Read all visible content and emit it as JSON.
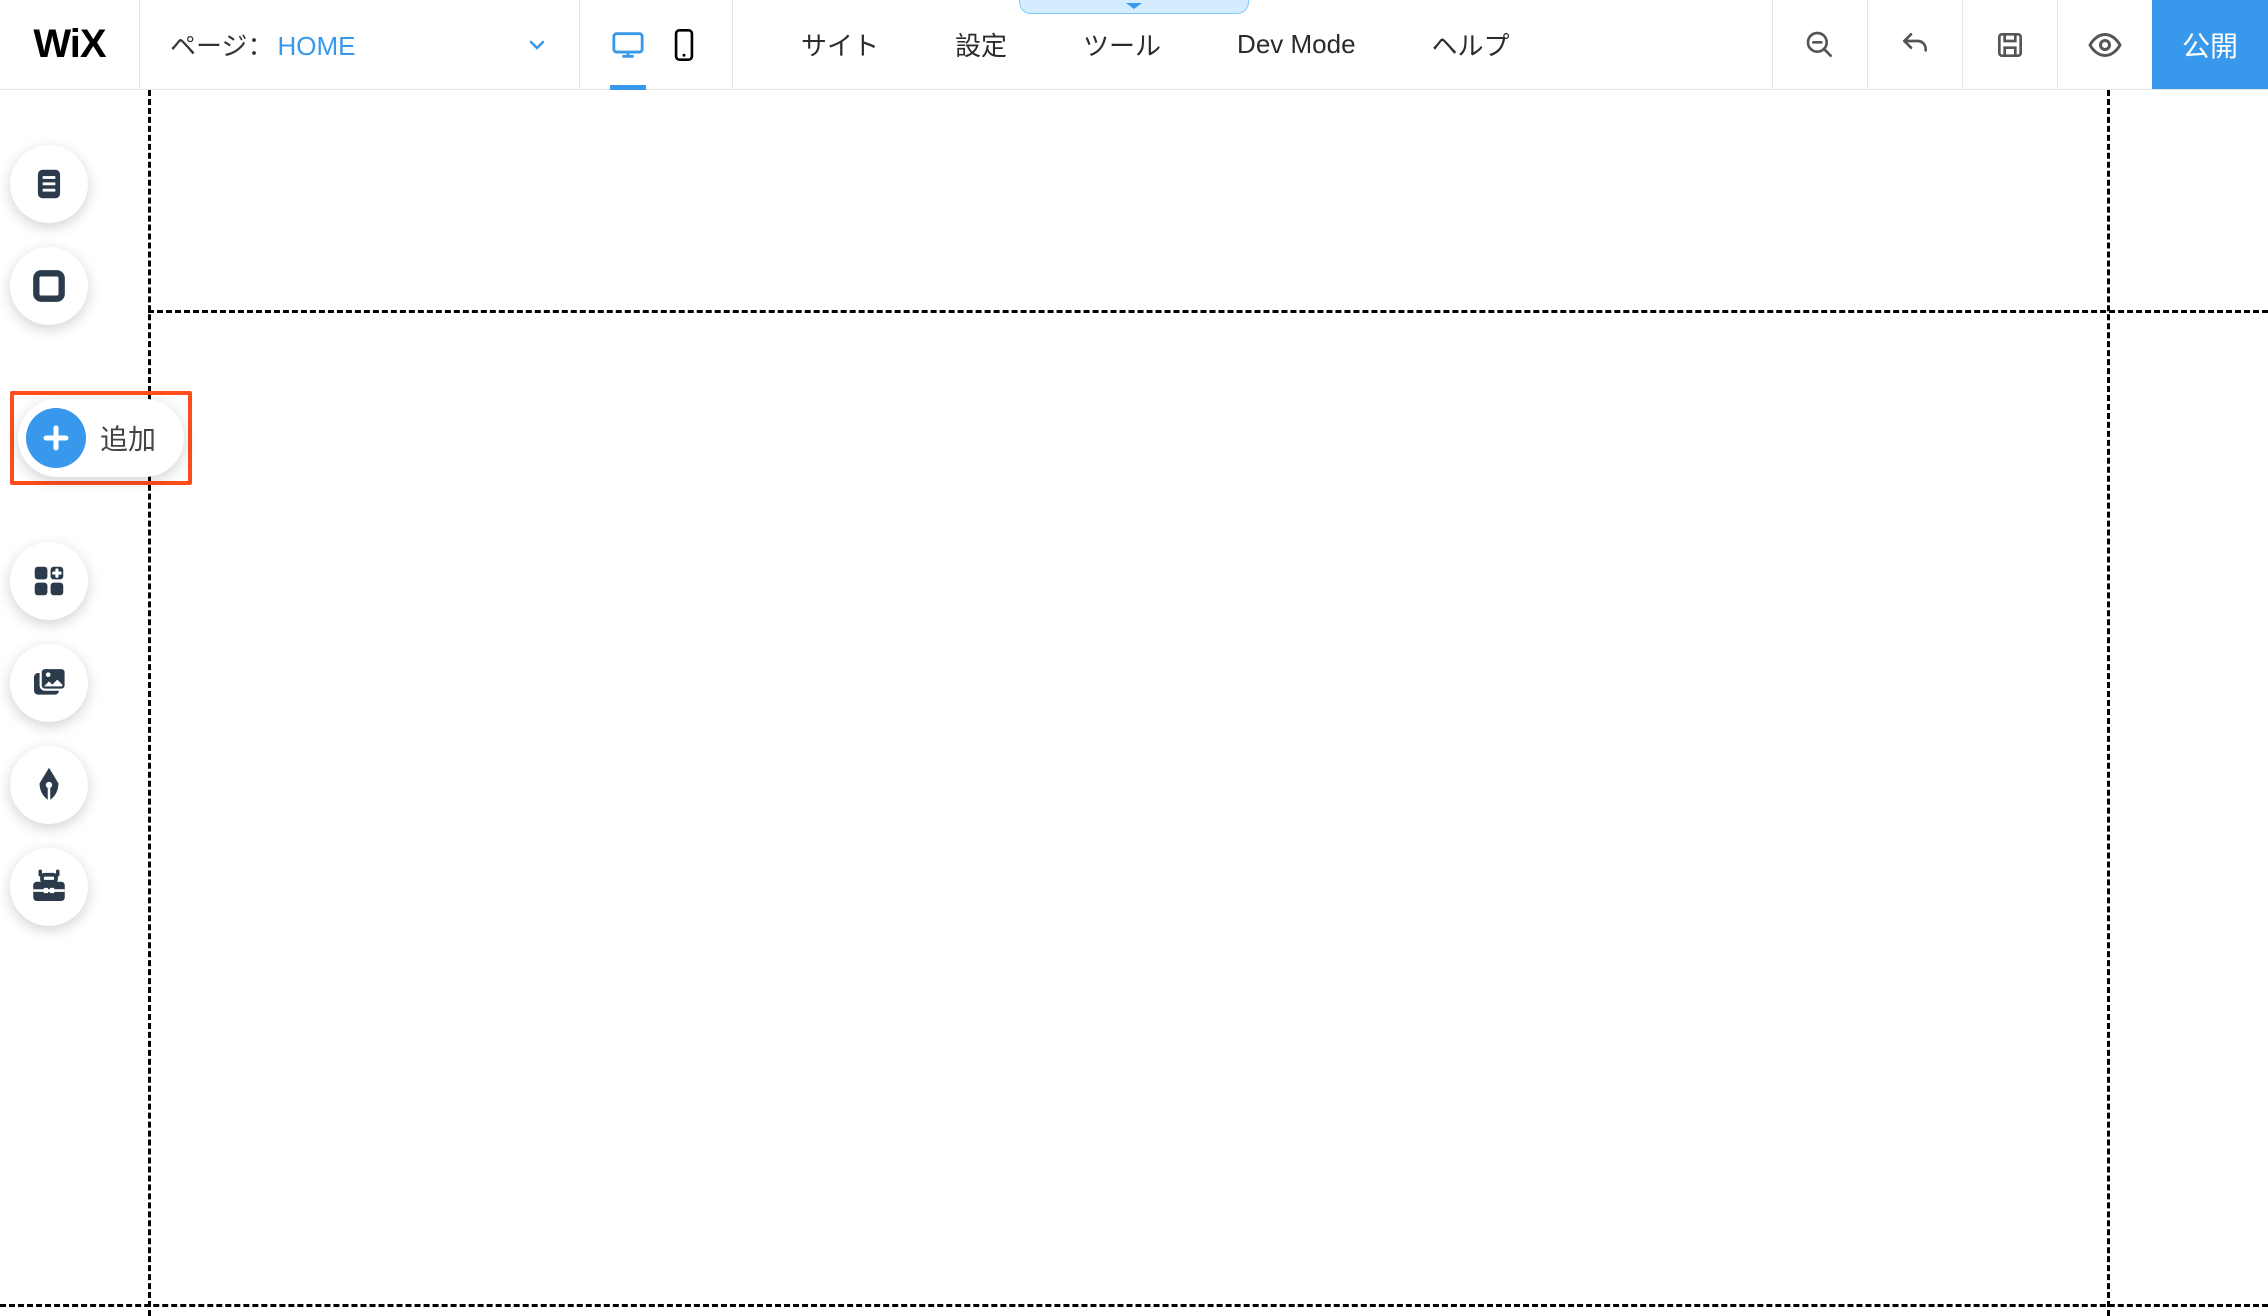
{
  "logo": "WiX",
  "page_selector": {
    "label": "ページ：",
    "name": "HOME"
  },
  "menu": {
    "site": "サイト",
    "settings": "設定",
    "tools": "ツール",
    "dev_mode": "Dev Mode",
    "help": "ヘルプ"
  },
  "publish_label": "公開",
  "sidebar": {
    "add_label": "追加"
  },
  "icons": {
    "pages": "pages-icon",
    "background": "square-icon",
    "add": "plus-icon",
    "apps": "apps-icon",
    "media": "media-icon",
    "blog": "pen-icon",
    "store": "toolbox-icon",
    "desktop": "desktop-icon",
    "mobile": "mobile-icon",
    "zoom": "zoom-out-icon",
    "undo": "undo-icon",
    "save": "save-icon",
    "preview": "preview-icon",
    "chevron": "chevron-down-icon"
  },
  "colors": {
    "accent": "#3899ec",
    "highlight": "#ff4d1c",
    "icon_dark": "#2b3b4c"
  }
}
